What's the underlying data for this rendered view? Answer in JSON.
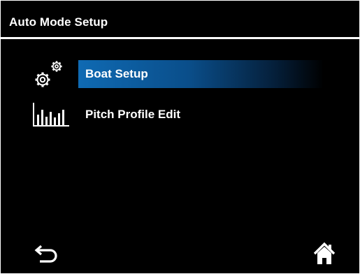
{
  "header": {
    "title": "Auto Mode Setup"
  },
  "menu": {
    "items": [
      {
        "label": "Boat Setup",
        "icon": "gears-icon",
        "selected": true
      },
      {
        "label": "Pitch Profile Edit",
        "icon": "bar-chart-icon",
        "selected": false
      }
    ]
  },
  "footer": {
    "back_icon": "back-arrow-icon",
    "home_icon": "home-icon"
  },
  "colors": {
    "background": "#000000",
    "text": "#ffffff",
    "selection_accent": "#0f6ab3",
    "divider": "#ffffff"
  }
}
